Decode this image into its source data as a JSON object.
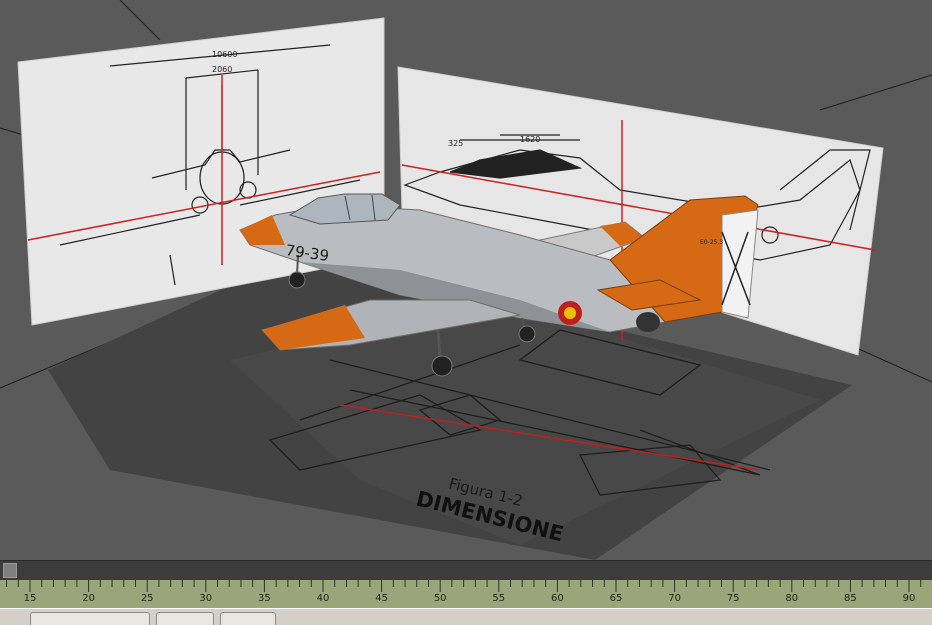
{
  "viewport": {
    "front_view_dims": {
      "overall_width": "10600",
      "inner_width": "2060"
    },
    "side_view_dims": {
      "dim_a": "325",
      "dim_b": "1620"
    },
    "aircraft": {
      "fuselage_code": "79-39",
      "tail_code": "E0-25.3"
    },
    "floor_drawing": {
      "figure_label": "Figura 1-2",
      "figure_title": "DIMENSIONE"
    },
    "colors": {
      "orange": "#d66a14",
      "fuselage_gray": "#b9bcc0",
      "ref_line": "#e02020",
      "floor": "#3e3e3e"
    }
  },
  "timeline": {
    "ticks": [
      "15",
      "20",
      "25",
      "30",
      "35",
      "40",
      "45",
      "50",
      "55",
      "60",
      "65",
      "70",
      "75",
      "80",
      "85",
      "90"
    ]
  }
}
